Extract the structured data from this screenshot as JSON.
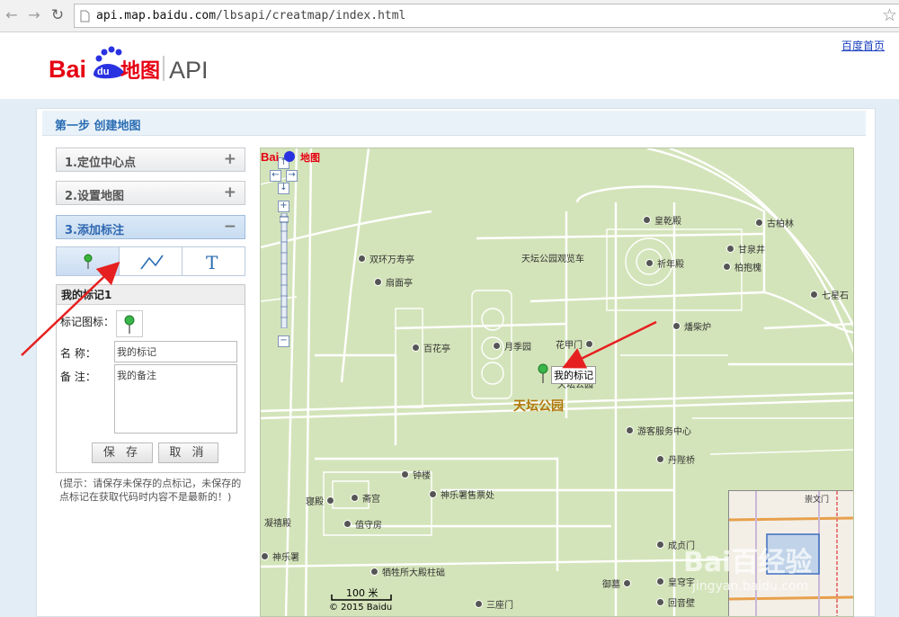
{
  "browser": {
    "url_host": "api.map.baidu.com",
    "url_path": "/lbsapi/creatmap/index.html"
  },
  "header": {
    "logo_text": "Baidu地图",
    "logo_api": "API",
    "home_link": "百度首页"
  },
  "step": {
    "title": "第一步 创建地图"
  },
  "accordion": [
    {
      "label": "1.定位中心点",
      "toggle": "+"
    },
    {
      "label": "2.设置地图",
      "toggle": "+"
    },
    {
      "label": "3.添加标注",
      "toggle": "−"
    }
  ],
  "tools": [
    "marker-tool",
    "polyline-tool",
    "text-tool"
  ],
  "form": {
    "title": "我的标记1",
    "icon_label": "标记图标：",
    "name_label": "名  称：",
    "name_value": "我的标记",
    "note_label": "备  注：",
    "note_value": "我的备注",
    "save": "保 存",
    "cancel": "取 消"
  },
  "tip": "(提示：请保存未保存的点标记，未保存的点标记在获取代码时内容不是最新的！)",
  "map": {
    "park_name": "天坛公园",
    "marker_label": "我的标记",
    "scale": "100 米",
    "copyright": "© 2015 Baidu",
    "pois": [
      {
        "name": "皇乾殿"
      },
      {
        "name": "古柏林"
      },
      {
        "name": "双环万寿亭"
      },
      {
        "name": "甘泉井"
      },
      {
        "name": "天坛公园观览车"
      },
      {
        "name": "祈年殿"
      },
      {
        "name": "柏抱槐"
      },
      {
        "name": "扇面亭"
      },
      {
        "name": "七星石"
      },
      {
        "name": "燔柴炉"
      },
      {
        "name": "百花亭"
      },
      {
        "name": "月季园"
      },
      {
        "name": "花甲门"
      },
      {
        "name": "天坛公园"
      },
      {
        "name": "游客服务中心"
      },
      {
        "name": "丹陛桥"
      },
      {
        "name": "钟楼"
      },
      {
        "name": "神乐署售票处"
      },
      {
        "name": "寝殿"
      },
      {
        "name": "斋宫"
      },
      {
        "name": "凝禧殿"
      },
      {
        "name": "值守房"
      },
      {
        "name": "神乐署"
      },
      {
        "name": "成贞门"
      },
      {
        "name": "牺牲所大殿柱础"
      },
      {
        "name": "御墓"
      },
      {
        "name": "皇穹宇"
      },
      {
        "name": "三座门"
      },
      {
        "name": "回音壁"
      },
      {
        "name": "崇文门"
      }
    ]
  },
  "watermark": "Bai百经验",
  "watermark_sub": "jingyan.baidu.com",
  "colors": {
    "accent": "#2a6db3",
    "map_bg": "#d4e4ba",
    "annotation_arrow": "#e62020"
  }
}
